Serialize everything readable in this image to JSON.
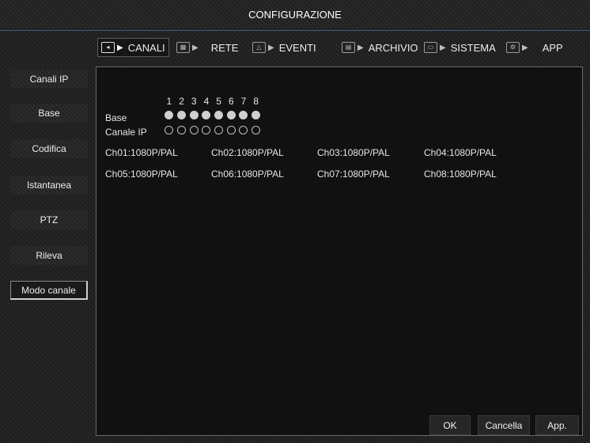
{
  "title": "CONFIGURAZIONE",
  "tabs": [
    {
      "label": "CANALI",
      "icon": "channel-icon",
      "active": true
    },
    {
      "label": "RETE",
      "icon": "network-icon",
      "active": false
    },
    {
      "label": "EVENTI",
      "icon": "alarm-icon",
      "active": false
    },
    {
      "label": "ARCHIVIO",
      "icon": "storage-icon",
      "active": false
    },
    {
      "label": "SISTEMA",
      "icon": "system-icon",
      "active": false
    },
    {
      "label": "APP",
      "icon": "app-icon",
      "active": false
    }
  ],
  "sidebar": {
    "items": [
      {
        "label": "Canali IP",
        "active": false
      },
      {
        "label": "Base",
        "active": false
      },
      {
        "label": "Codifica",
        "active": false
      },
      {
        "label": "Istantanea",
        "active": false
      },
      {
        "label": "PTZ",
        "active": false
      },
      {
        "label": "Rileva",
        "active": false
      },
      {
        "label": "Modo canale",
        "active": true
      }
    ]
  },
  "channel_mode": {
    "numbers": [
      "1",
      "2",
      "3",
      "4",
      "5",
      "6",
      "7",
      "8"
    ],
    "base_label": "Base",
    "ip_label": "Canale IP",
    "base_selected": [
      true,
      true,
      true,
      true,
      true,
      true,
      true,
      true
    ],
    "ip_selected": [
      false,
      false,
      false,
      false,
      false,
      false,
      false,
      false
    ],
    "channels": [
      "Ch01:1080P/PAL",
      "Ch02:1080P/PAL",
      "Ch03:1080P/PAL",
      "Ch04:1080P/PAL",
      "Ch05:1080P/PAL",
      "Ch06:1080P/PAL",
      "Ch07:1080P/PAL",
      "Ch08:1080P/PAL"
    ]
  },
  "buttons": {
    "ok": "OK",
    "cancel": "Cancella",
    "apply": "App."
  },
  "colors": {
    "accent_line": "#3a5f8a",
    "panel_bg": "#111111"
  }
}
